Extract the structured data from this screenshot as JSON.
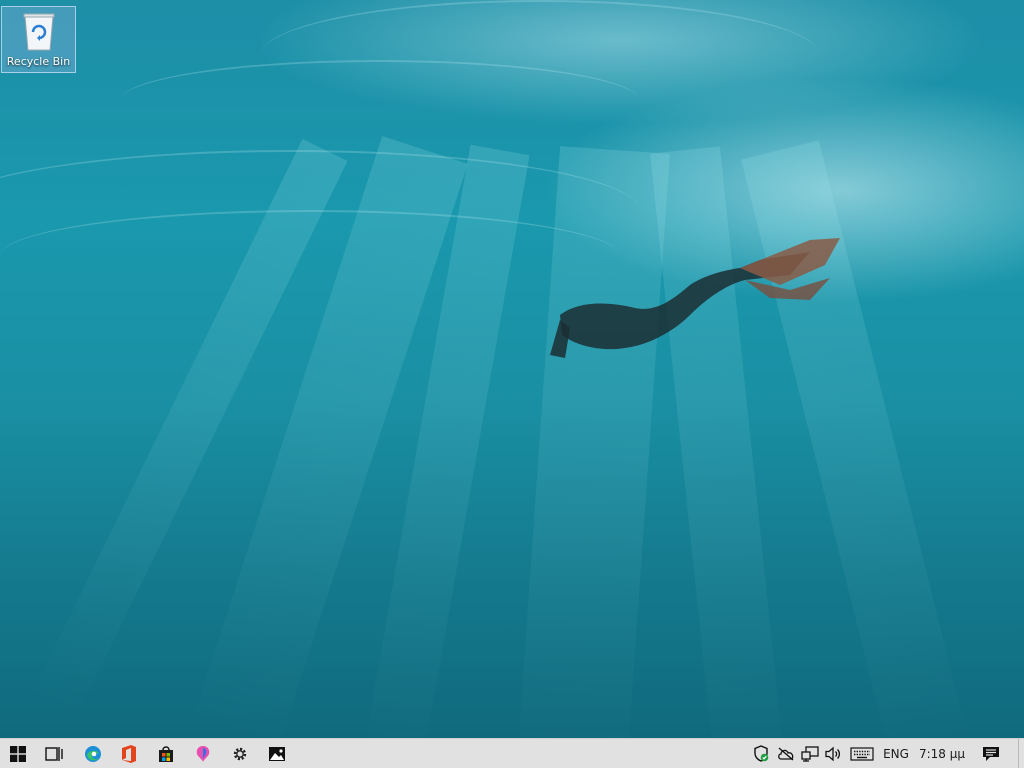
{
  "desktop": {
    "icons": [
      {
        "label": "Recycle Bin",
        "icon": "recycle-bin-icon"
      }
    ]
  },
  "taskbar": {
    "pinned": [
      {
        "icon": "windows-start-icon"
      },
      {
        "icon": "task-view-icon"
      },
      {
        "icon": "edge-browser-icon"
      },
      {
        "icon": "office-icon"
      },
      {
        "icon": "store-icon"
      },
      {
        "icon": "paint-3d-icon"
      },
      {
        "icon": "settings-gear-icon"
      },
      {
        "icon": "photos-icon"
      }
    ],
    "tray": {
      "icons": [
        "security-shield-icon",
        "onedrive-offline-icon",
        "network-icon",
        "volume-icon",
        "touch-keyboard-icon"
      ],
      "language": "ENG",
      "time": "7:18 μμ",
      "notifications_icon": "action-center-icon"
    }
  },
  "colors": {
    "taskbar_bg": "#e1e1e1",
    "water_light": "#1a98ad",
    "water_dark": "#106a7e"
  }
}
